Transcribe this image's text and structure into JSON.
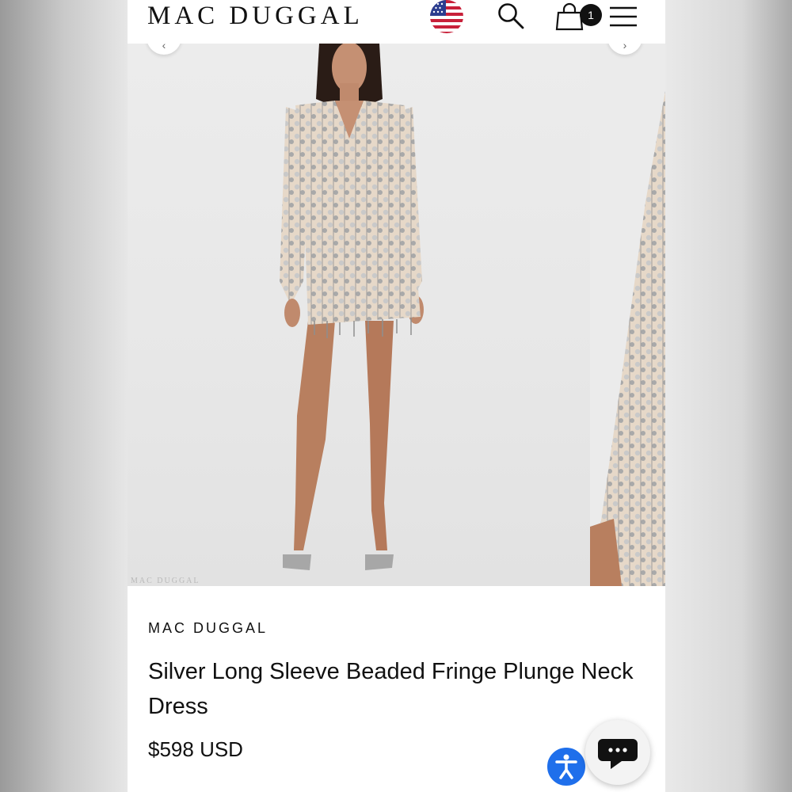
{
  "header": {
    "logo": "MAC DUGGAL",
    "cart_count": "1"
  },
  "icons": {
    "flag": "us-flag-icon",
    "search": "search-icon",
    "bag": "shopping-bag-icon",
    "menu": "hamburger-menu-icon",
    "accessibility": "accessibility-icon",
    "chat": "chat-icon"
  },
  "gallery": {
    "watermark": "MAC DUGGAL"
  },
  "product": {
    "brand": "MAC DUGGAL",
    "title": "Silver Long Sleeve Beaded Fringe Plunge Neck Dress",
    "price": "$598 USD"
  },
  "colors": {
    "accessibility_blue": "#1f6feb",
    "text": "#111111"
  }
}
